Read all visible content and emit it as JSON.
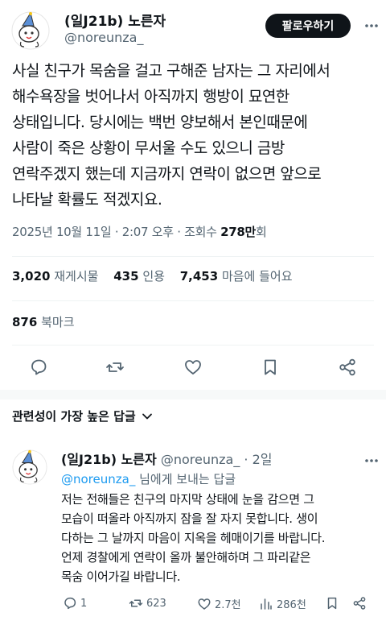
{
  "author": {
    "display_name": "(일J21b) 노른자",
    "handle": "@noreunza_",
    "avatar": "doodle-avatar"
  },
  "follow_label": "팔로우하기",
  "tweet": {
    "text": "사실 친구가 목숨을 걸고 구해준 남자는 그 자리에서\n해수욕장을 벗어나서 아직까지 행방이 묘연한\n상태입니다. 당시에는 백번 양보해서 본인때문에\n사람이 죽은 상황이 무서울 수도 있으니 금방\n연락주겠지 했는데 지금까지 연락이 없으면 앞으로\n나타날 확률도 적겠지요.",
    "timestamp": "2025년 10월 11일 · 2:07 오후 · 조회수 ",
    "views": "278만",
    "views_suffix": "회"
  },
  "stats": {
    "retweets": "3,020",
    "retweets_label": "재게시물",
    "quotes": "435",
    "quotes_label": "인용",
    "likes": "7,453",
    "likes_label": "마음에 들어요",
    "bookmarks": "876",
    "bookmarks_label": "북마크"
  },
  "actions": [
    "reply-icon",
    "retweet-icon",
    "like-icon",
    "bookmark-icon",
    "share-icon"
  ],
  "sort_label": "관련성이 가장 높은 답글",
  "reply": {
    "display_name": "(일J21b) 노른자",
    "handle": "@noreunza_",
    "time": "· 2일",
    "reply_to_mention": "@noreunza_",
    "reply_to_suffix": " 님에게 보내는 답글",
    "text": "저는 전해들은 친구의 마지막 상태에 눈을 감으면 그\n모습이 떠올라 아직까지 잠을 잘 자지 못합니다. 생이\n다하는 그 날까지 마음이 지옥을 헤매이기를 바랍니다.\n언제 경찰에게 연락이 올까 불안해하며 그 파리같은\n목숨 이어가길 바랍니다.",
    "replies": "1",
    "retweets": "623",
    "likes": "2.7천",
    "views": "286천"
  },
  "colors": {
    "text": "#0f1419",
    "muted": "#536471",
    "link": "#1d9bf0",
    "button": "#0f1419"
  }
}
